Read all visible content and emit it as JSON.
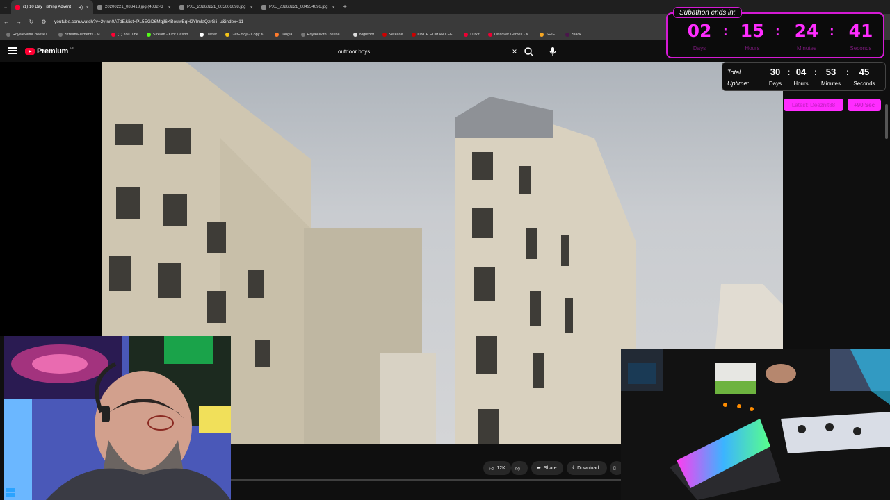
{
  "browser": {
    "tabs": [
      {
        "title": "(1) 10 Day Fishing Advent",
        "active": true,
        "icon": "youtube-icon"
      },
      {
        "title": "20200221_083413.jpg (4032×3",
        "active": false,
        "icon": "image-icon"
      },
      {
        "title": "PXL_20260221_005006098.jpg",
        "active": false,
        "icon": "image-icon"
      },
      {
        "title": "PXL_20260221_004954096.jpg",
        "active": false,
        "icon": "image-icon"
      }
    ],
    "new_tab_label": "+",
    "url": "youtube.com/watch?v=2yInn0ATdE&list=PL5EGD6Mqjl6KBouwBqH2YlmlaQzrGli_u&index=11",
    "bookmarks": [
      "RoyaleWithCheeseT...",
      "StreamElements - M...",
      "(1) YouTube",
      "Stream - Kick Dashb...",
      "Twitter",
      "GetEmoji - Copy &...",
      "Tangia",
      "RoyaleWithCheeseT...",
      "NightBot",
      "Netease",
      "ONCE HUMAN CFE...",
      "Lurkit",
      "Discover Games - K...",
      "SHIFT",
      "Slack"
    ]
  },
  "youtube": {
    "logo_text": "Premium",
    "logo_country": "DE",
    "search_value": "outdoor boys",
    "actions": {
      "likes": "12K",
      "share": "Share",
      "download": "Download"
    }
  },
  "overlay": {
    "subathon_title": "Subathon ends in:",
    "countdown": [
      {
        "value": "02",
        "label": "Days"
      },
      {
        "value": "15",
        "label": "Hours"
      },
      {
        "value": "24",
        "label": "Minutes"
      },
      {
        "value": "41",
        "label": "Seconds"
      }
    ],
    "countdown_sep": ":",
    "uptime_label_1": "Total",
    "uptime_label_2": "Uptime:",
    "uptime": [
      {
        "value": "30",
        "label": "Days"
      },
      {
        "value": "04",
        "label": "Hours"
      },
      {
        "value": "53",
        "label": "Minutes"
      },
      {
        "value": "45",
        "label": "Seconds"
      }
    ],
    "latest_text": "Latest: Deeznit88",
    "bonus_text": "+90 Sec",
    "accent_color": "#ff2cff"
  }
}
